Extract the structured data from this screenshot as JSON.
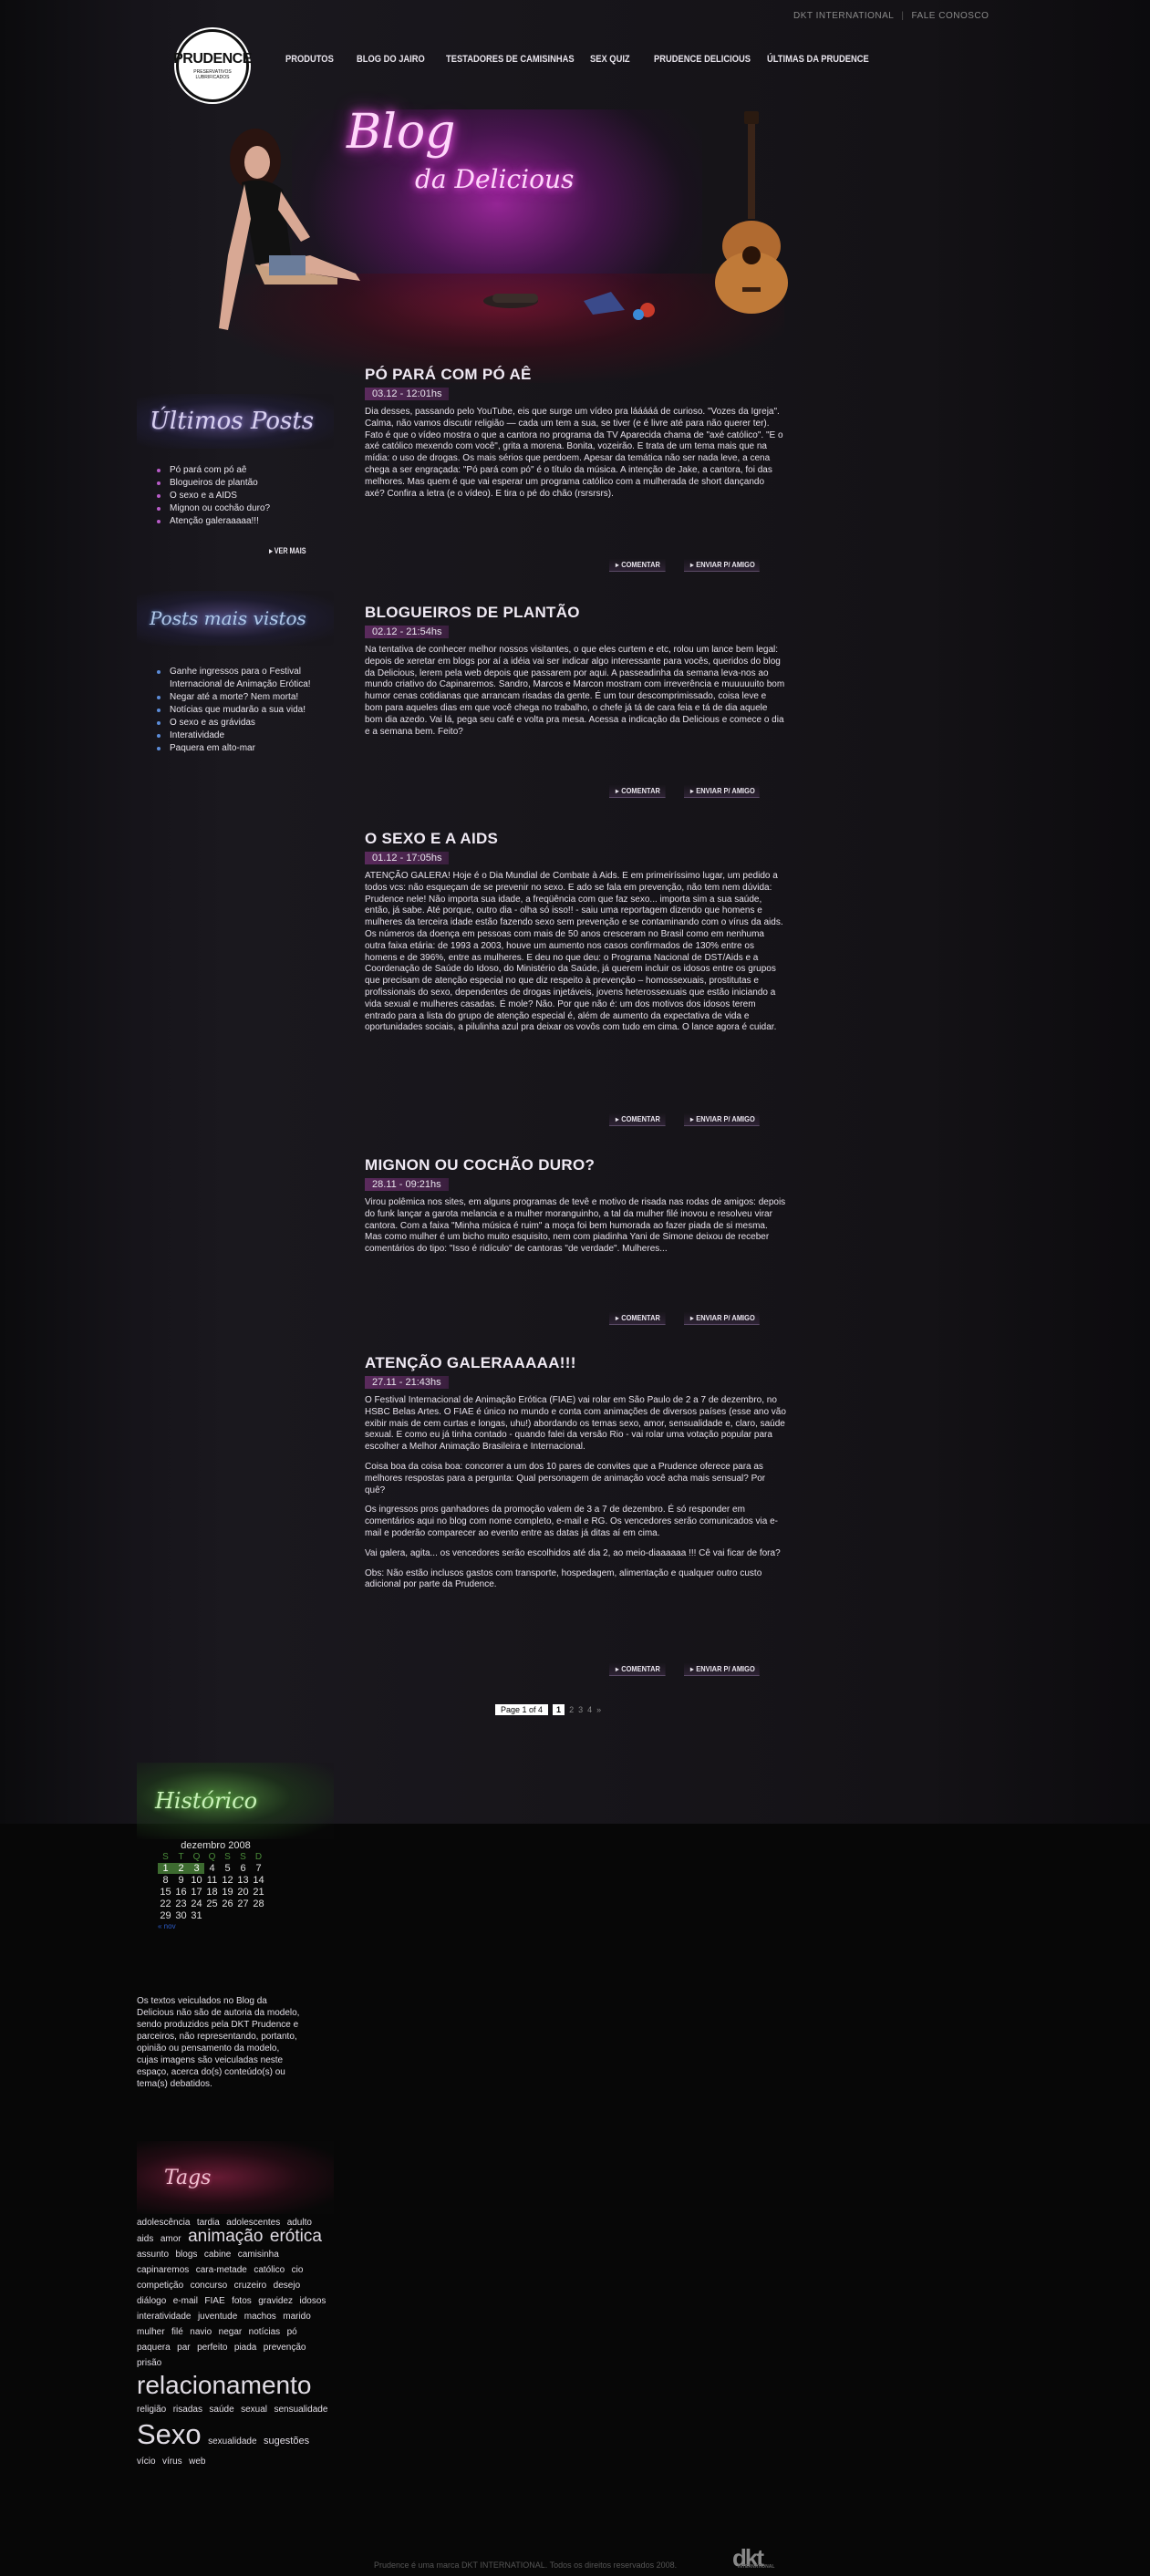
{
  "top_links": {
    "dkt": "DKT INTERNATIONAL",
    "contact": "FALE CONOSCO"
  },
  "logo": {
    "text": "PRUDENCE",
    "sub": "PRESERVATIVOS LUBRIFICADOS"
  },
  "nav": [
    "PRODUTOS",
    "BLOG DO JAIRO",
    "TESTADORES DE CAMISINHAS",
    "SEX QUIZ",
    "PRUDENCE DELICIOUS",
    "ÚLTIMAS DA PRUDENCE"
  ],
  "hero": {
    "title": "Blog",
    "subtitle": "da Delicious"
  },
  "ultimos": {
    "title": "Últimos Posts",
    "items": [
      "Pó pará com pó aê",
      "Blogueiros de plantão",
      "O sexo e a AIDS",
      "Mignon ou cochão duro?",
      "Atenção galeraaaaa!!!"
    ],
    "more": "VER MAIS"
  },
  "mais_vistos": {
    "title": "Posts mais vistos",
    "items": [
      "Ganhe ingressos para o Festival Internacional de Animação Erótica!",
      "Negar até a morte? Nem morta!",
      "Notícias que mudarão a sua vida!",
      "O sexo e as grávidas",
      "Interatividade",
      "Paquera em alto-mar"
    ]
  },
  "actions": {
    "comment": "COMENTAR",
    "send": "ENVIAR P/ AMIGO"
  },
  "posts": [
    {
      "title": "PÓ PARÁ COM PÓ AÊ",
      "date": "03.12 - 12:01hs",
      "body": "Dia desses, passando pelo YouTube, eis que surge um vídeo pra lááááá de curioso. \"Vozes da Igreja\". Calma, não vamos discutir religião — cada um tem a sua, se tiver (e é livre até para não querer ter). Fato é que o vídeo mostra o que a cantora no programa da TV Aparecida chama de \"axé católico\". \"E o axé católico mexendo com você\", grita a morena. Bonita, vozeirão. E trata de um tema mais que na mídia: o uso de drogas. Os mais sérios que perdoem. Apesar da temática não ser nada leve, a cena chega a ser engraçada: \"Pó pará com pó\" é o título da música. A intenção de Jake, a cantora, foi das melhores. Mas quem é que vai esperar um programa católico com a mulherada de short dançando axé? Confira a letra (e o vídeo). E tira o pé do chão (rsrsrsrs)."
    },
    {
      "title": "BLOGUEIROS DE PLANTÃO",
      "date": "02.12 - 21:54hs",
      "body": "Na tentativa de conhecer melhor nossos visitantes, o que eles curtem e etc, rolou um lance bem legal: depois de xeretar em blogs por aí a idéia vai ser indicar algo interessante para vocês, queridos do blog da Delicious, lerem pela web depois que passarem por aqui. A passeadinha da semana leva-nos ao mundo criativo do Capinaremos. Sandro, Marcos e Marcon mostram com irreverência e muuuuuito bom humor cenas cotidianas que arrancam risadas da gente. É um tour descomprimissado, coisa leve e bom para aqueles dias em que você chega no trabalho, o chefe já tá de cara feia e tá de dia aquele bom dia azedo. Vai lá, pega seu café e volta pra mesa. Acessa a indicação da Delicious e comece o dia e a semana bem. Feito?"
    },
    {
      "title": "O SEXO E A AIDS",
      "date": "01.12 - 17:05hs",
      "body": "ATENÇÃO GALERA! Hoje é o Dia Mundial de Combate à Aids. E em primeiríssimo lugar, um pedido a todos vcs: não esqueçam de se prevenir no sexo. E ado se fala em prevenção, não tem nem dúvida: Prudence nele! Não importa sua idade, a freqüência com que faz sexo... importa sim a sua saúde, então, já sabe. Até porque, outro dia - olha só isso!! - saiu uma reportagem dizendo que homens e mulheres da terceira idade estão fazendo sexo sem prevenção e se contaminando com o vírus da aids. Os números da doença em pessoas com mais de 50 anos cresceram no Brasil como em nenhuma outra faixa etária: de 1993 a 2003, houve um aumento nos casos confirmados de 130% entre os homens e de 396%, entre as mulheres. E deu no que deu: o Programa Nacional de DST/Aids e a Coordenação de Saúde do Idoso, do Ministério da Saúde, já querem incluir os idosos entre os grupos que precisam de atenção especial no que diz respeito à prevenção – homossexuais, prostitutas e profissionais do sexo, dependentes de drogas injetáveis, jovens heterossexuais que estão iniciando a vida sexual e mulheres casadas. É mole? Não. Por que não é: um dos motivos dos idosos terem entrado para a lista do grupo de atenção especial é, além de aumento da expectativa de vida e oportunidades sociais, a pilulinha azul pra deixar os vovôs com tudo em cima. O lance agora é cuidar."
    },
    {
      "title": "MIGNON OU COCHÃO DURO?",
      "date": "28.11 - 09:21hs",
      "body": "Virou polêmica nos sites, em alguns programas de tevê e motivo de risada nas rodas de amigos: depois do funk lançar a garota melancia e a mulher moranguinho, a tal da mulher filé inovou e resolveu virar cantora. Com a faixa \"Minha música é ruim\" a moça foi bem humorada ao fazer piada de si mesma. Mas como mulher é um bicho muito esquisito, nem com piadinha Yani de Simone deixou de receber comentários do tipo: \"Isso é ridículo\" de cantoras \"de verdade\". Mulheres..."
    },
    {
      "title": "ATENÇÃO GALERAAAAA!!!",
      "date": "27.11 - 21:43hs",
      "paragraphs": [
        "O Festival Internacional de Animação Erótica (FIAE) vai rolar em São Paulo de 2 a 7 de dezembro, no HSBC Belas Artes. O FIAE é único no mundo e conta com animações de diversos países (esse ano vão exibir mais de cem curtas e longas, uhu!) abordando os temas sexo, amor, sensualidade e, claro, saúde sexual. E como eu já tinha contado - quando falei da versão Rio - vai rolar uma  votação popular para escolher a Melhor Animação Brasileira e Internacional.",
        "Coisa boa da coisa boa: concorrer a um dos 10 pares de convites que a Prudence oferece para as melhores respostas para a pergunta: Qual personagem de animação você acha mais sensual? Por quê?",
        "Os ingressos pros ganhadores da promoção valem de 3 a 7 de dezembro. É só responder em comentários aqui no blog com nome completo, e-mail e RG. Os vencedores serão comunicados via e-mail e poderão comparecer ao evento entre as datas já ditas aí em cima.",
        "Vai galera, agita... os vencedores serão escolhidos até dia 2, ao meio-diaaaaaa !!! Cê vai ficar de fora?",
        "Obs: Não estão inclusos gastos com transporte, hospedagem, alimentação e qualquer outro custo adicional por parte da Prudence."
      ]
    }
  ],
  "pagination": {
    "info": "Page 1 of 4",
    "current": "1",
    "pages": [
      "2",
      "3",
      "4",
      "»"
    ]
  },
  "historico": {
    "title": "Histórico",
    "month": "dezembro 2008",
    "day_headers": [
      "S",
      "T",
      "Q",
      "Q",
      "S",
      "S",
      "D"
    ],
    "rows": [
      [
        "1",
        "2",
        "3",
        "4",
        "5",
        "6",
        "7"
      ],
      [
        "8",
        "9",
        "10",
        "11",
        "12",
        "13",
        "14"
      ],
      [
        "15",
        "16",
        "17",
        "18",
        "19",
        "20",
        "21"
      ],
      [
        "22",
        "23",
        "24",
        "25",
        "26",
        "27",
        "28"
      ],
      [
        "29",
        "30",
        "31",
        "",
        "",
        "",
        ""
      ]
    ],
    "prev": "« nov"
  },
  "disclaimer": "Os textos veiculados no Blog da Delicious não são de autoria da modelo, sendo produzidos pela DKT Prudence e parceiros, não representando, portanto, opinião ou pensamento da modelo, cujas imagens são veiculadas neste espaço, acerca do(s) conteúdo(s) ou tema(s) debatidos.",
  "tags": {
    "title": "Tags",
    "cloud": [
      {
        "text": "adolescência",
        "size": 1
      },
      {
        "text": "tardia",
        "size": 1
      },
      {
        "text": "adolescentes",
        "size": 1
      },
      {
        "text": "adulto",
        "size": 1
      },
      {
        "text": "aids",
        "size": 1
      },
      {
        "text": "amor",
        "size": 1
      },
      {
        "text": "animação",
        "size": 3
      },
      {
        "text": "erótica",
        "size": 3
      },
      {
        "text": "assunto",
        "size": 1
      },
      {
        "text": "blogs",
        "size": 1
      },
      {
        "text": "cabine",
        "size": 1
      },
      {
        "text": "camisinha",
        "size": 1
      },
      {
        "text": "capinaremos",
        "size": 1
      },
      {
        "text": "cara-metade",
        "size": 1
      },
      {
        "text": "católico",
        "size": 1
      },
      {
        "text": "cio",
        "size": 1
      },
      {
        "text": "competição",
        "size": 1
      },
      {
        "text": "concurso",
        "size": 1
      },
      {
        "text": "cruzeiro",
        "size": 1
      },
      {
        "text": "desejo",
        "size": 1
      },
      {
        "text": "diálogo",
        "size": 1
      },
      {
        "text": "e-mail",
        "size": 1
      },
      {
        "text": "FIAE",
        "size": 1
      },
      {
        "text": "fotos",
        "size": 1
      },
      {
        "text": "gravidez",
        "size": 1
      },
      {
        "text": "idosos",
        "size": 1
      },
      {
        "text": "interatividade",
        "size": 1
      },
      {
        "text": "juventude",
        "size": 1
      },
      {
        "text": "machos",
        "size": 1
      },
      {
        "text": "marido",
        "size": 1
      },
      {
        "text": "mulher",
        "size": 1
      },
      {
        "text": "filé",
        "size": 1
      },
      {
        "text": "navio",
        "size": 1
      },
      {
        "text": "negar",
        "size": 1
      },
      {
        "text": "notícias",
        "size": 1
      },
      {
        "text": "pó",
        "size": 1
      },
      {
        "text": "paquera",
        "size": 1
      },
      {
        "text": "par",
        "size": 1
      },
      {
        "text": "perfeito",
        "size": 1
      },
      {
        "text": "piada",
        "size": 1
      },
      {
        "text": "prevenção",
        "size": 1
      },
      {
        "text": "prisão",
        "size": 1
      },
      {
        "text": "relacionamento",
        "size": 4
      },
      {
        "text": "religião",
        "size": 1
      },
      {
        "text": "risadas",
        "size": 1
      },
      {
        "text": "saúde",
        "size": 1
      },
      {
        "text": "sexual",
        "size": 1
      },
      {
        "text": "sensualidade",
        "size": 1
      },
      {
        "text": "Sexo",
        "size": 5
      },
      {
        "text": "sexualidade",
        "size": 1
      },
      {
        "text": "sugestões",
        "size": 2
      },
      {
        "text": "vício",
        "size": 1
      },
      {
        "text": "vírus",
        "size": 1
      },
      {
        "text": "web",
        "size": 1
      }
    ]
  },
  "footer": {
    "text": "Prudence é uma marca DKT INTERNATIONAL. Todos os direitos reservados 2008.",
    "logo": "dkt",
    "logo_sub": "INTERNATIONAL"
  }
}
